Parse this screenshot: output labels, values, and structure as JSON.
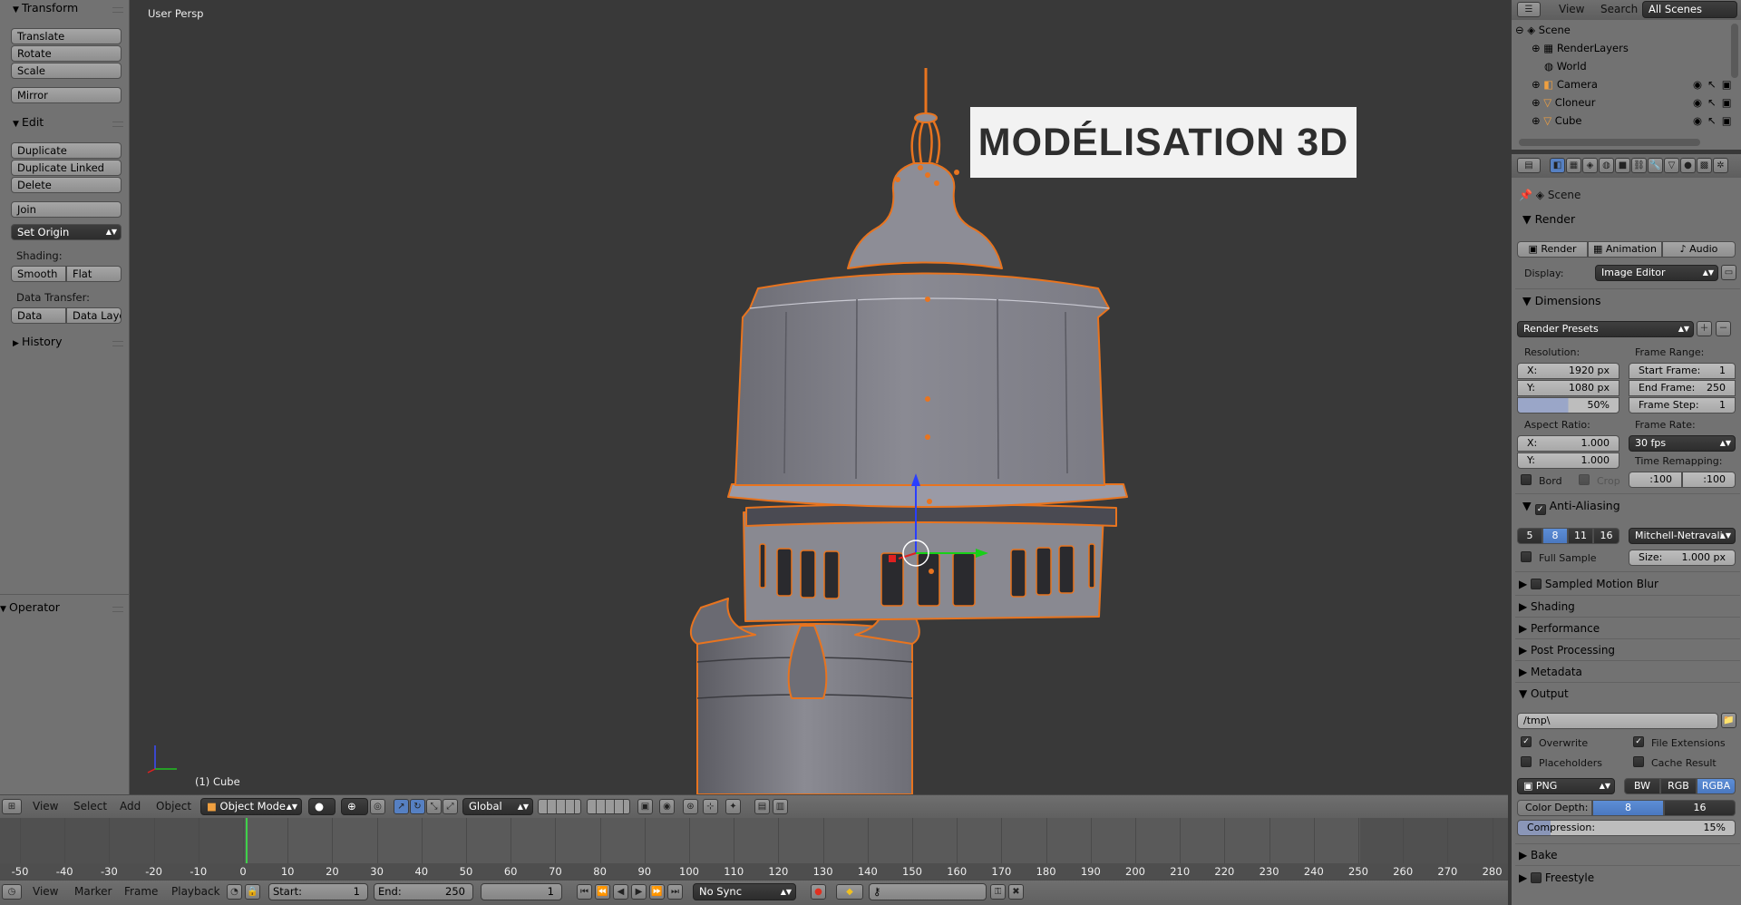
{
  "toolshelf": {
    "transform_header": "Transform",
    "translate": "Translate",
    "rotate": "Rotate",
    "scale": "Scale",
    "mirror": "Mirror",
    "edit_header": "Edit",
    "duplicate": "Duplicate",
    "duplicate_linked": "Duplicate Linked",
    "delete": "Delete",
    "join": "Join",
    "set_origin": "Set Origin",
    "shading_label": "Shading:",
    "smooth": "Smooth",
    "flat": "Flat",
    "data_transfer_label": "Data Transfer:",
    "data": "Data",
    "data_layout": "Data Layo",
    "history_header": "History",
    "operator_header": "Operator"
  },
  "viewport": {
    "title": "User Persp",
    "active_object": "(1) Cube",
    "overlay_title": "MODÉLISATION 3D"
  },
  "view3d_header": {
    "view": "View",
    "select": "Select",
    "add": "Add",
    "object": "Object",
    "mode": "Object Mode",
    "orientation": "Global"
  },
  "timeline": {
    "ticks": [
      "-50",
      "-40",
      "-30",
      "-20",
      "-10",
      "0",
      "10",
      "20",
      "30",
      "40",
      "50",
      "60",
      "70",
      "80",
      "90",
      "100",
      "110",
      "120",
      "130",
      "140",
      "150",
      "160",
      "170",
      "180",
      "190",
      "200",
      "210",
      "220",
      "230",
      "240",
      "250",
      "260",
      "270",
      "280"
    ],
    "current_frame_marker": 0
  },
  "timeline_header": {
    "view": "View",
    "marker": "Marker",
    "frame": "Frame",
    "playback": "Playback",
    "start_label": "Start:",
    "start_value": "1",
    "end_label": "End:",
    "end_value": "250",
    "current_value": "1",
    "sync": "No Sync"
  },
  "outliner": {
    "view": "View",
    "search": "Search",
    "filter": "All Scenes",
    "items": [
      "Scene",
      "RenderLayers",
      "World",
      "Camera",
      "Cloneur",
      "Cube"
    ]
  },
  "properties": {
    "breadcrumb": "Scene",
    "render_header": "Render",
    "render_btn": "Render",
    "animation_btn": "Animation",
    "audio_btn": "Audio",
    "display_label": "Display:",
    "display_value": "Image Editor",
    "dimensions_header": "Dimensions",
    "render_presets": "Render Presets",
    "resolution_label": "Resolution:",
    "res_x_label": "X:",
    "res_x": "1920 px",
    "res_y_label": "Y:",
    "res_y": "1080 px",
    "res_pct": "50%",
    "frame_range_label": "Frame Range:",
    "start_frame_label": "Start Frame:",
    "start_frame": "1",
    "end_frame_label": "End Frame:",
    "end_frame": "250",
    "frame_step_label": "Frame Step:",
    "frame_step": "1",
    "aspect_label": "Aspect Ratio:",
    "aspect_x_label": "X:",
    "aspect_x": "1.000",
    "aspect_y_label": "Y:",
    "aspect_y": "1.000",
    "frame_rate_label": "Frame Rate:",
    "frame_rate": "30 fps",
    "time_remap_label": "Time Remapping:",
    "remap_old": ":100",
    "remap_new": ":100",
    "bord": "Bord",
    "crop": "Crop",
    "aa_header": "Anti-Aliasing",
    "aa_samples": [
      "5",
      "8",
      "11",
      "16"
    ],
    "aa_selected": "8",
    "aa_filter": "Mitchell-Netravali",
    "full_sample": "Full Sample",
    "size_label": "Size:",
    "size_value": "1.000 px",
    "sampled_motion_blur": "Sampled Motion Blur",
    "shading": "Shading",
    "performance": "Performance",
    "post_processing": "Post Processing",
    "metadata": "Metadata",
    "output_header": "Output",
    "output_path": "/tmp\\",
    "overwrite": "Overwrite",
    "file_extensions": "File Extensions",
    "placeholders": "Placeholders",
    "cache_result": "Cache Result",
    "format": "PNG",
    "bw": "BW",
    "rgb": "RGB",
    "rgba": "RGBA",
    "color_depth_label": "Color Depth:",
    "depth_8": "8",
    "depth_16": "16",
    "compression_label": "Compression:",
    "compression_value": "15%",
    "bake": "Bake",
    "freestyle": "Freestyle"
  },
  "colors": {
    "viewport_bg": "#393939",
    "panel_bg": "#727272",
    "selection_outline": "#e8741f",
    "accent_blue": "#5680c2"
  }
}
